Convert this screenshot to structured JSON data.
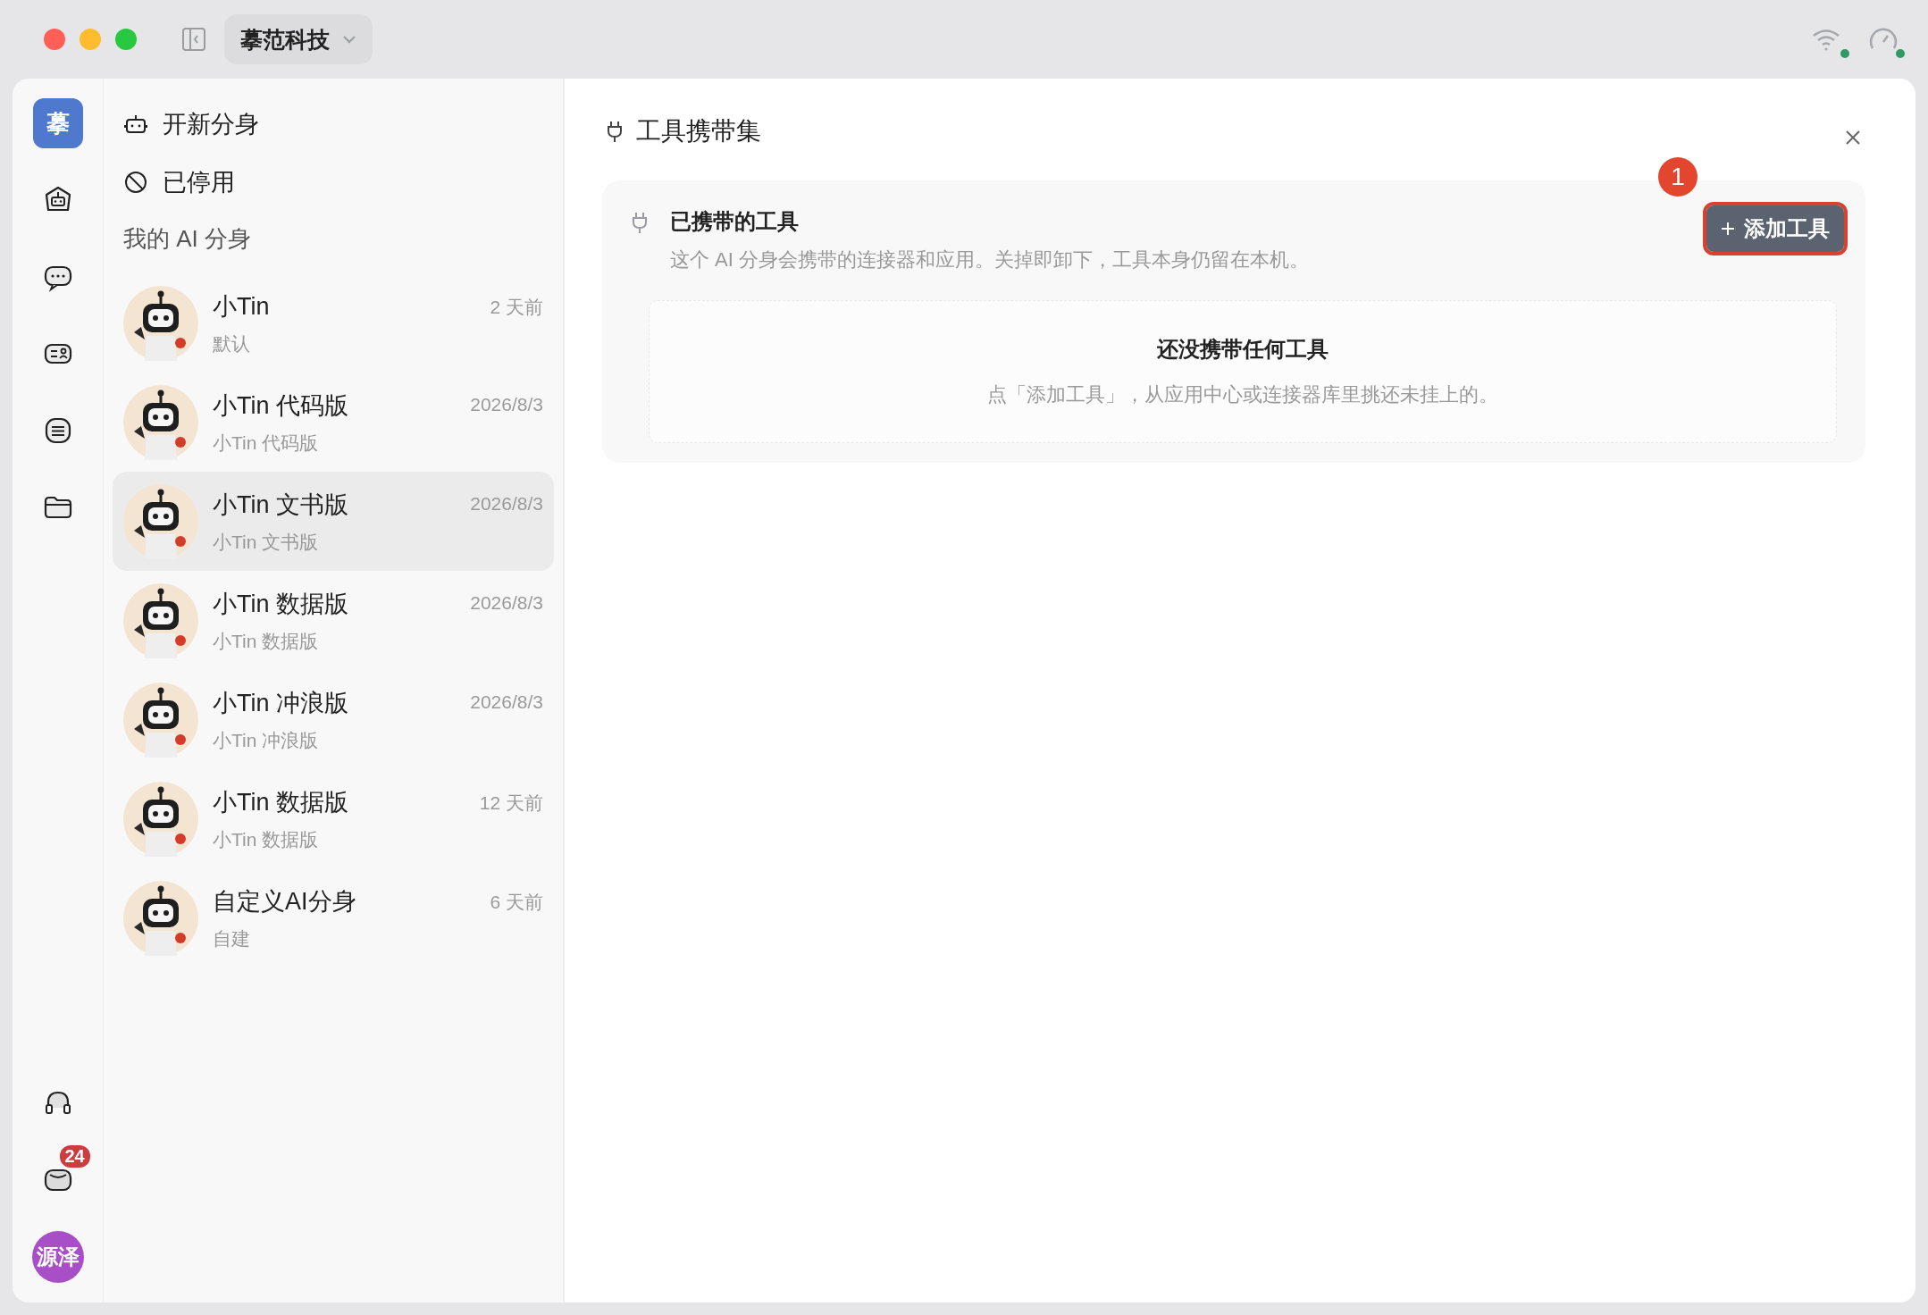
{
  "titlebar": {
    "workspace": "摹范科技"
  },
  "rail": {
    "logo": "摹",
    "mail_badge": "24",
    "user": "源泽"
  },
  "menu": [
    {
      "kind": "new",
      "label": "开新分身"
    },
    {
      "kind": "disabled",
      "label": "已停用"
    }
  ],
  "section_title": "我的 AI 分身",
  "agents": [
    {
      "name": "小Tin",
      "subtitle": "默认",
      "time": "2 天前",
      "selected": false
    },
    {
      "name": "小Tin 代码版",
      "subtitle": "小Tin 代码版",
      "time": "2026/8/3",
      "selected": false
    },
    {
      "name": "小Tin 文书版",
      "subtitle": "小Tin 文书版",
      "time": "2026/8/3",
      "selected": true
    },
    {
      "name": "小Tin 数据版",
      "subtitle": "小Tin 数据版",
      "time": "2026/8/3",
      "selected": false
    },
    {
      "name": "小Tin 冲浪版",
      "subtitle": "小Tin 冲浪版",
      "time": "2026/8/3",
      "selected": false
    },
    {
      "name": "小Tin 数据版",
      "subtitle": "小Tin 数据版",
      "time": "12 天前",
      "selected": false
    },
    {
      "name": "自定义AI分身",
      "subtitle": "自建",
      "time": "6 天前",
      "selected": false
    }
  ],
  "panel": {
    "title": "工具携带集",
    "section": {
      "heading": "已携带的工具",
      "description": "这个 AI 分身会携带的连接器和应用。关掉即卸下，工具本身仍留在本机。",
      "button": "添加工具",
      "annotation": "1"
    },
    "empty": {
      "title": "还没携带任何工具",
      "text": "点「添加工具」，从应用中心或连接器库里挑还未挂上的。"
    }
  }
}
